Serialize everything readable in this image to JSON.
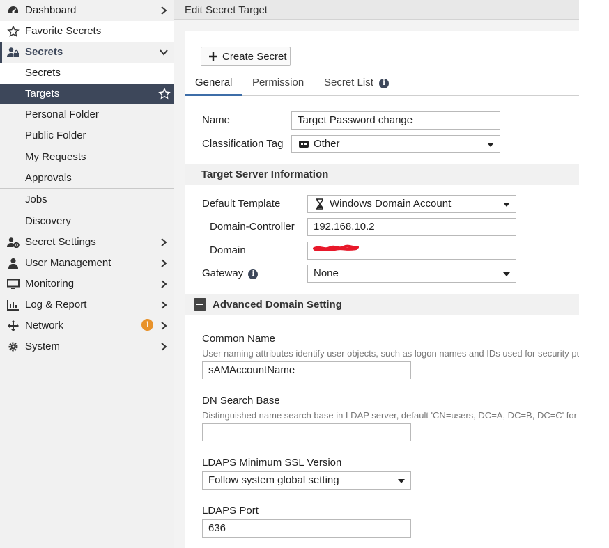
{
  "sidebar": {
    "items": [
      {
        "label": "Dashboard",
        "icon": "dashboard-icon"
      },
      {
        "label": "Favorite Secrets",
        "icon": "star-icon"
      },
      {
        "label": "Secrets",
        "icon": "user-lock-icon"
      },
      {
        "label": "Secrets"
      },
      {
        "label": "Targets",
        "icon": "star-outline-icon"
      },
      {
        "label": "Personal Folder"
      },
      {
        "label": "Public Folder"
      },
      {
        "label": "My Requests"
      },
      {
        "label": "Approvals"
      },
      {
        "label": "Jobs"
      },
      {
        "label": "Discovery"
      },
      {
        "label": "Secret Settings",
        "icon": "user-gear-icon"
      },
      {
        "label": "User Management",
        "icon": "user-icon"
      },
      {
        "label": "Monitoring",
        "icon": "monitor-icon"
      },
      {
        "label": "Log & Report",
        "icon": "bar-chart-icon"
      },
      {
        "label": "Network",
        "icon": "move-arrows-icon",
        "badge": "1"
      },
      {
        "label": "System",
        "icon": "gear-icon"
      }
    ]
  },
  "header": {
    "title": "Edit Secret Target"
  },
  "toolbar": {
    "create_label": "Create Secret"
  },
  "tabs": [
    "General",
    "Permission",
    "Secret List"
  ],
  "form": {
    "name_label": "Name",
    "name_value": "Target Password change",
    "classification_label": "Classification Tag",
    "classification_value": "Other",
    "server_section": "Target Server Information",
    "template_label": "Default Template",
    "template_value": "Windows Domain Account",
    "dc_label": "Domain-Controller",
    "dc_value": "192.168.10.2",
    "domain_label": "Domain",
    "gateway_label": "Gateway",
    "gateway_value": "None",
    "advanced_section": "Advanced Domain Setting",
    "cn_label": "Common Name",
    "cn_help": "User naming attributes identify user objects, such as logon names and IDs used for security purpo",
    "cn_value": "sAMAccountName",
    "dn_label": "DN Search Base",
    "dn_help": "Distinguished name search base in LDAP server, default 'CN=users, DC=A, DC=B, DC=C' for A.B",
    "dn_value": "",
    "ssl_label": "LDAPS Minimum SSL Version",
    "ssl_value": "Follow system global setting",
    "port_label": "LDAPS Port",
    "port_value": "636"
  },
  "colors": {
    "sidebar_active": "#3d475a",
    "badge": "#e8922a",
    "tab_accent": "#3d6da8",
    "redaction": "#e8182a"
  }
}
